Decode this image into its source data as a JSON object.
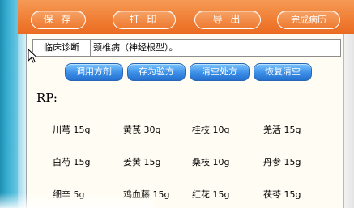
{
  "toolbar": {
    "save_label": "保 存",
    "print_label": "打 印",
    "export_label": "导 出",
    "complete_label": "完成病历"
  },
  "diagnosis": {
    "label": "临床诊断",
    "value": "颈椎病（神经根型）。"
  },
  "actions": {
    "apply_formula": "调用方剂",
    "save_formula": "存为验方",
    "clear_prescription": "清空处方",
    "restore_clear": "恢复清空"
  },
  "rp_label": "RP:",
  "herbs": [
    {
      "name": "川芎",
      "dose": "15g"
    },
    {
      "name": "黄芪",
      "dose": "30g"
    },
    {
      "name": "桂枝",
      "dose": "10g"
    },
    {
      "name": "羌活",
      "dose": "15g"
    },
    {
      "name": "白芍",
      "dose": "15g"
    },
    {
      "name": "姜黄",
      "dose": "15g"
    },
    {
      "name": "桑枝",
      "dose": "10g"
    },
    {
      "name": "丹参",
      "dose": "15g"
    },
    {
      "name": "细辛",
      "dose": "5g"
    },
    {
      "name": "鸡血藤",
      "dose": "15g"
    },
    {
      "name": "红花",
      "dose": "15g"
    },
    {
      "name": "茯苓",
      "dose": "15g"
    }
  ],
  "colors": {
    "toolbar_orange": "#f07d33",
    "action_blue": "#3b8fe6",
    "panel_bg": "#fffdf3"
  }
}
